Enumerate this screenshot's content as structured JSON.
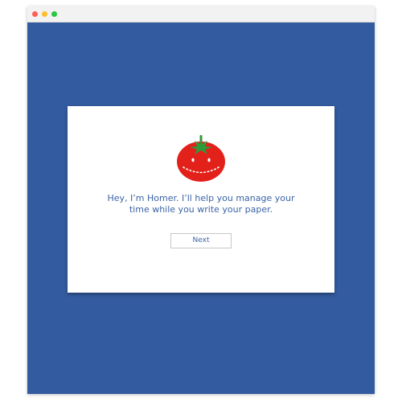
{
  "colors": {
    "background": "#335b9f",
    "accent_text": "#3a63a6",
    "tomato_red": "#e3211b",
    "leaf_green": "#2f9a3a",
    "dot_red": "#ff5f57",
    "dot_yellow": "#ffbd2e",
    "dot_green": "#28c840"
  },
  "dialog": {
    "logo_icon": "tomato-timer-icon",
    "message_line1": "Hey, I’m Homer. I’ll help you manage your",
    "message_line2": "time while you write your paper.",
    "next_label": "Next"
  }
}
